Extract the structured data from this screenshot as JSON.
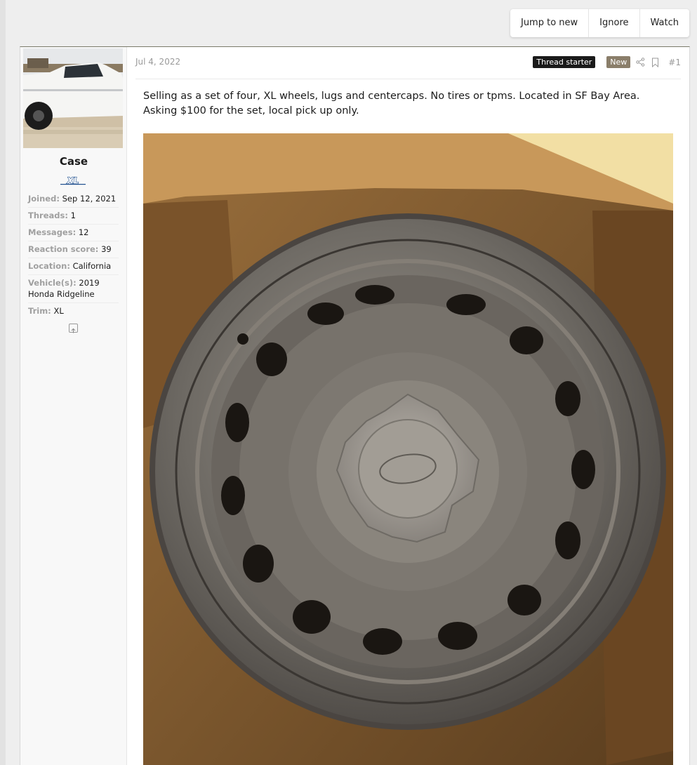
{
  "thread_actions": {
    "jump_to_new": "Jump to new",
    "ignore": "Ignore",
    "watch": "Watch"
  },
  "post": {
    "date": "Jul 4, 2022",
    "thread_starter_label": "Thread starter",
    "new_label": "New",
    "post_number": "#1",
    "body": "Selling as a set of four, XL wheels, lugs and centercaps. No tires or tpms. Located in SF Bay Area. Asking $100 for the set, local pick up only.",
    "share_icon": "share-icon",
    "bookmark_icon": "bookmark-icon"
  },
  "user": {
    "name": "Case",
    "badge_text": "XL",
    "stats": [
      {
        "label": "Joined:",
        "value": "Sep 12, 2021"
      },
      {
        "label": "Threads:",
        "value": "1"
      },
      {
        "label": "Messages:",
        "value": "12"
      },
      {
        "label": "Reaction score:",
        "value": "39"
      },
      {
        "label": "Location:",
        "value": "California"
      },
      {
        "label": "Vehicle(s):",
        "value": "2019 Honda Ridgeline"
      },
      {
        "label": "Trim:",
        "value": "XL"
      }
    ]
  },
  "colors": {
    "page_bg": "#eeeeee",
    "thread_starter_bg": "#1a1a1a",
    "new_tag_bg": "#8a7e6a",
    "label_gray": "#a0a0a0"
  }
}
